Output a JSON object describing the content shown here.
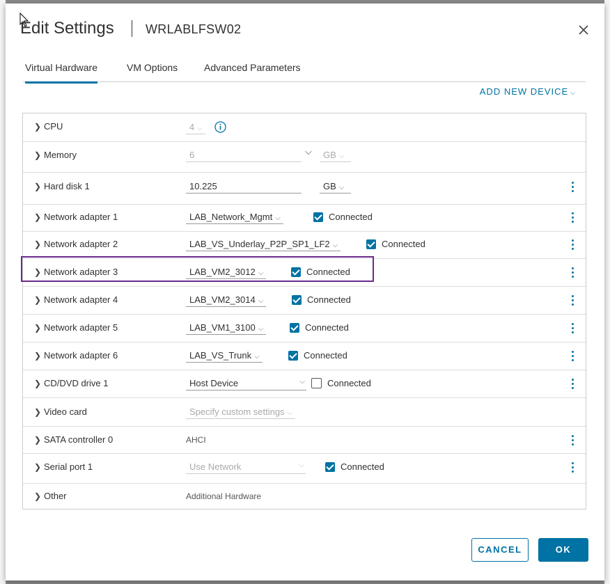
{
  "dialog": {
    "title": "Edit Settings",
    "vm_name": "WRLABLFSW02",
    "close_icon": "close-icon"
  },
  "tabs": [
    {
      "label": "Virtual Hardware",
      "active": true
    },
    {
      "label": "VM Options",
      "active": false
    },
    {
      "label": "Advanced Parameters",
      "active": false
    }
  ],
  "add_new_device": "ADD NEW DEVICE",
  "hardware": {
    "cpu": {
      "label": "CPU",
      "value": "4"
    },
    "memory": {
      "label": "Memory",
      "value": "6",
      "unit": "GB"
    },
    "hard_disk_1": {
      "label": "Hard disk 1",
      "value": "10.225",
      "unit": "GB"
    },
    "network_adapters": [
      {
        "label": "Network adapter 1",
        "network": "LAB_Network_Mgmt",
        "connected_label": "Connected",
        "connected": true
      },
      {
        "label": "Network adapter 2",
        "network": "LAB_VS_Underlay_P2P_SP1_LF2",
        "connected_label": "Connected",
        "connected": true
      },
      {
        "label": "Network adapter 3",
        "network": "LAB_VM2_3012",
        "connected_label": "Connected",
        "connected": true
      },
      {
        "label": "Network adapter 4",
        "network": "LAB_VM2_3014",
        "connected_label": "Connected",
        "connected": true
      },
      {
        "label": "Network adapter 5",
        "network": "LAB_VM1_3100",
        "connected_label": "Connected",
        "connected": true
      },
      {
        "label": "Network adapter 6",
        "network": "LAB_VS_Trunk",
        "connected_label": "Connected",
        "connected": true
      }
    ],
    "cd_dvd_drive_1": {
      "label": "CD/DVD drive 1",
      "value": "Host Device",
      "connected_label": "Connected",
      "connected": false
    },
    "video_card": {
      "label": "Video card",
      "value": "Specify custom settings"
    },
    "sata_controller_0": {
      "label": "SATA controller 0",
      "value": "AHCI"
    },
    "serial_port_1": {
      "label": "Serial port 1",
      "value": "Use Network",
      "connected_label": "Connected",
      "connected": true
    },
    "other": {
      "label": "Other",
      "value": "Additional Hardware"
    }
  },
  "buttons": {
    "cancel": "CANCEL",
    "ok": "OK"
  },
  "colors": {
    "accent": "#0072a3",
    "highlight_border": "#6a2a8a"
  }
}
